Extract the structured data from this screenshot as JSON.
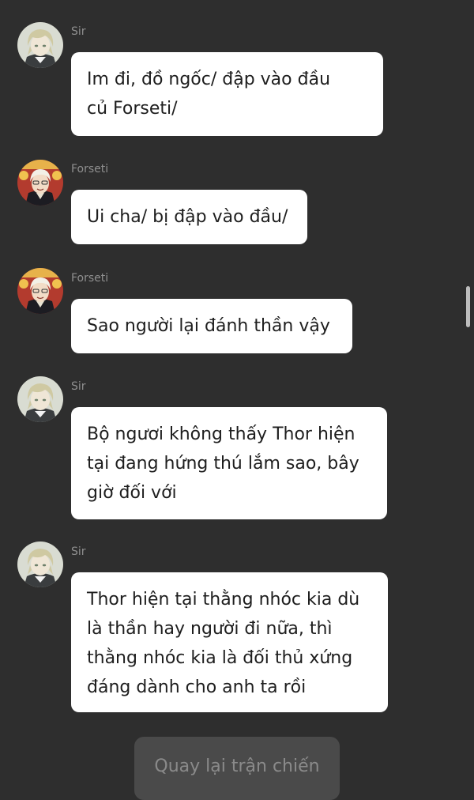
{
  "colors": {
    "background": "#2e2e2e",
    "bubble": "#ffffff",
    "bubble_text": "#1e1e1e",
    "sender_name": "#8f8f8f",
    "button_bg": "#4a4a4a",
    "button_text": "#8a8a8a"
  },
  "messages": [
    {
      "sender": "Sir",
      "avatar": "sir-avatar",
      "text": "Im đi, đồ ngốc/ đập vào đầu\ncủ Forseti/"
    },
    {
      "sender": "Forseti",
      "avatar": "forseti-avatar",
      "text": "Ui cha/ bị đập vào đầu/"
    },
    {
      "sender": "Forseti",
      "avatar": "forseti-avatar",
      "text": "Sao người lại đánh thần vậy"
    },
    {
      "sender": "Sir",
      "avatar": "sir-avatar",
      "text": "Bộ ngươi không thấy Thor hiện\ntại đang hứng thú lắm sao, bây\ngiờ đối với"
    },
    {
      "sender": "Sir",
      "avatar": "sir-avatar",
      "text": "Thor hiện tại thằng nhóc kia dù\nlà thần hay người đi nữa, thì\nthằng nhóc kia là đối thủ xứng\nđáng dành cho anh ta rồi"
    }
  ],
  "back_button": {
    "label": "Quay lại trận chiến"
  }
}
